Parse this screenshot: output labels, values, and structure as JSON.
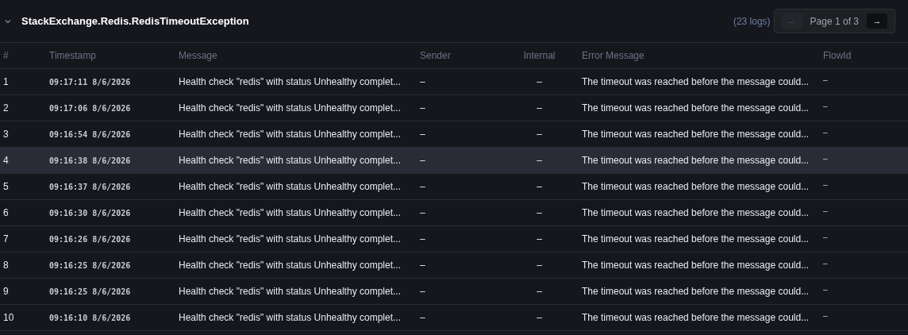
{
  "group": {
    "expanded": true,
    "title": "StackExchange.Redis.RedisTimeoutException",
    "count": "(23 logs)"
  },
  "pagination": {
    "prev": {
      "label": "←",
      "disabled": true
    },
    "page": "Page 1 of 3",
    "next": {
      "label": "→",
      "disabled": false
    }
  },
  "table": {
    "columns": [
      "#",
      "Timestamp",
      "Message",
      "Sender",
      "Internal",
      "Error Message",
      "FlowId"
    ],
    "rows": [
      {
        "n": "1",
        "timestamp": "09:17:11 8/6/2026",
        "message": "Health check \"redis\" with status Unhealthy complet...",
        "sender": "–",
        "internal": "–",
        "error": "The timeout was reached before the message could...",
        "flow": "–",
        "hovered": false
      },
      {
        "n": "2",
        "timestamp": "09:17:06 8/6/2026",
        "message": "Health check \"redis\" with status Unhealthy complet...",
        "sender": "–",
        "internal": "–",
        "error": "The timeout was reached before the message could...",
        "flow": "–",
        "hovered": false
      },
      {
        "n": "3",
        "timestamp": "09:16:54 8/6/2026",
        "message": "Health check \"redis\" with status Unhealthy complet...",
        "sender": "–",
        "internal": "–",
        "error": "The timeout was reached before the message could...",
        "flow": "–",
        "hovered": false
      },
      {
        "n": "4",
        "timestamp": "09:16:38 8/6/2026",
        "message": "Health check \"redis\" with status Unhealthy complet...",
        "sender": "–",
        "internal": "–",
        "error": "The timeout was reached before the message could...",
        "flow": "–",
        "hovered": true
      },
      {
        "n": "5",
        "timestamp": "09:16:37 8/6/2026",
        "message": "Health check \"redis\" with status Unhealthy complet...",
        "sender": "–",
        "internal": "–",
        "error": "The timeout was reached before the message could...",
        "flow": "–",
        "hovered": false
      },
      {
        "n": "6",
        "timestamp": "09:16:30 8/6/2026",
        "message": "Health check \"redis\" with status Unhealthy complet...",
        "sender": "–",
        "internal": "–",
        "error": "The timeout was reached before the message could...",
        "flow": "–",
        "hovered": false
      },
      {
        "n": "7",
        "timestamp": "09:16:26 8/6/2026",
        "message": "Health check \"redis\" with status Unhealthy complet...",
        "sender": "–",
        "internal": "–",
        "error": "The timeout was reached before the message could...",
        "flow": "–",
        "hovered": false
      },
      {
        "n": "8",
        "timestamp": "09:16:25 8/6/2026",
        "message": "Health check \"redis\" with status Unhealthy complet...",
        "sender": "–",
        "internal": "–",
        "error": "The timeout was reached before the message could...",
        "flow": "–",
        "hovered": false
      },
      {
        "n": "9",
        "timestamp": "09:16:25 8/6/2026",
        "message": "Health check \"redis\" with status Unhealthy complet...",
        "sender": "–",
        "internal": "–",
        "error": "The timeout was reached before the message could...",
        "flow": "–",
        "hovered": false
      },
      {
        "n": "10",
        "timestamp": "09:16:10 8/6/2026",
        "message": "Health check \"redis\" with status Unhealthy complet...",
        "sender": "–",
        "internal": "–",
        "error": "The timeout was reached before the message could...",
        "flow": "–",
        "hovered": false
      }
    ]
  }
}
